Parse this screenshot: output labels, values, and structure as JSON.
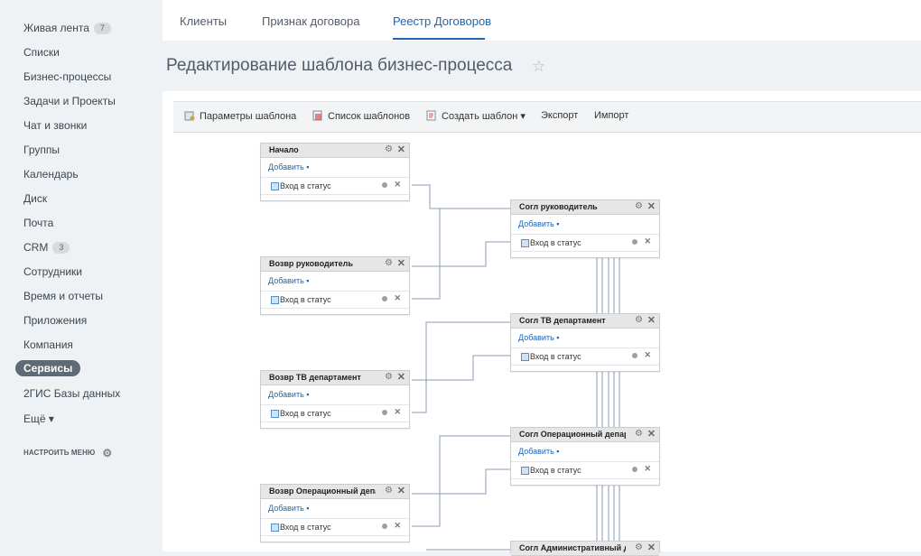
{
  "sidebar": {
    "items": [
      {
        "label": "Живая лента",
        "badge": "7"
      },
      {
        "label": "Списки"
      },
      {
        "label": "Бизнес-процессы"
      },
      {
        "label": "Задачи и Проекты"
      },
      {
        "label": "Чат и звонки"
      },
      {
        "label": "Группы"
      },
      {
        "label": "Календарь"
      },
      {
        "label": "Диск"
      },
      {
        "label": "Почта"
      },
      {
        "label": "CRM",
        "badge": "3"
      },
      {
        "label": "Сотрудники"
      },
      {
        "label": "Время и отчеты"
      },
      {
        "label": "Приложения"
      },
      {
        "label": "Компания"
      },
      {
        "label": "Сервисы",
        "active": true
      },
      {
        "label": "2ГИС Базы данных"
      },
      {
        "label": "Ещё ▾"
      }
    ],
    "settings_label": "НАСТРОИТЬ МЕНЮ"
  },
  "tabs": [
    {
      "label": "Клиенты"
    },
    {
      "label": "Признак договора"
    },
    {
      "label": "Реестр Договоров",
      "active": true
    }
  ],
  "page_title": "Редактирование шаблона бизнес-процесса",
  "toolbar": {
    "params_label": "Параметры шаблона",
    "list_label": "Список шаблонов",
    "create_label": "Создать шаблон ▾",
    "export_label": "Экспорт",
    "import_label": "Импорт"
  },
  "nodes": [
    {
      "title": "Начало",
      "add": "Добавить ▪",
      "row": "Вход в статус"
    },
    {
      "title": "Согл руководитель",
      "add": "Добавить ▪",
      "row": "Вход в статус"
    },
    {
      "title": "Возвр руководитель",
      "add": "Добавить ▪",
      "row": "Вход в статус"
    },
    {
      "title": "Согл ТВ департамент",
      "add": "Добавить ▪",
      "row": "Вход в статус"
    },
    {
      "title": "Возвр ТВ департамент",
      "add": "Добавить ▪",
      "row": "Вход в статус"
    },
    {
      "title": "Согл Операционный департамент",
      "add": "Добавить ▪",
      "row": "Вход в статус"
    },
    {
      "title": "Возвр Операционный департамент",
      "add": "Добавить ▪",
      "row": "Вход в статус"
    },
    {
      "title": "Согл Административный департамент",
      "add": "",
      "row": ""
    }
  ],
  "colors": {
    "accent": "#2067b0",
    "sidebar_bg": "#eef2f4",
    "wire": "#8a9bb5"
  }
}
